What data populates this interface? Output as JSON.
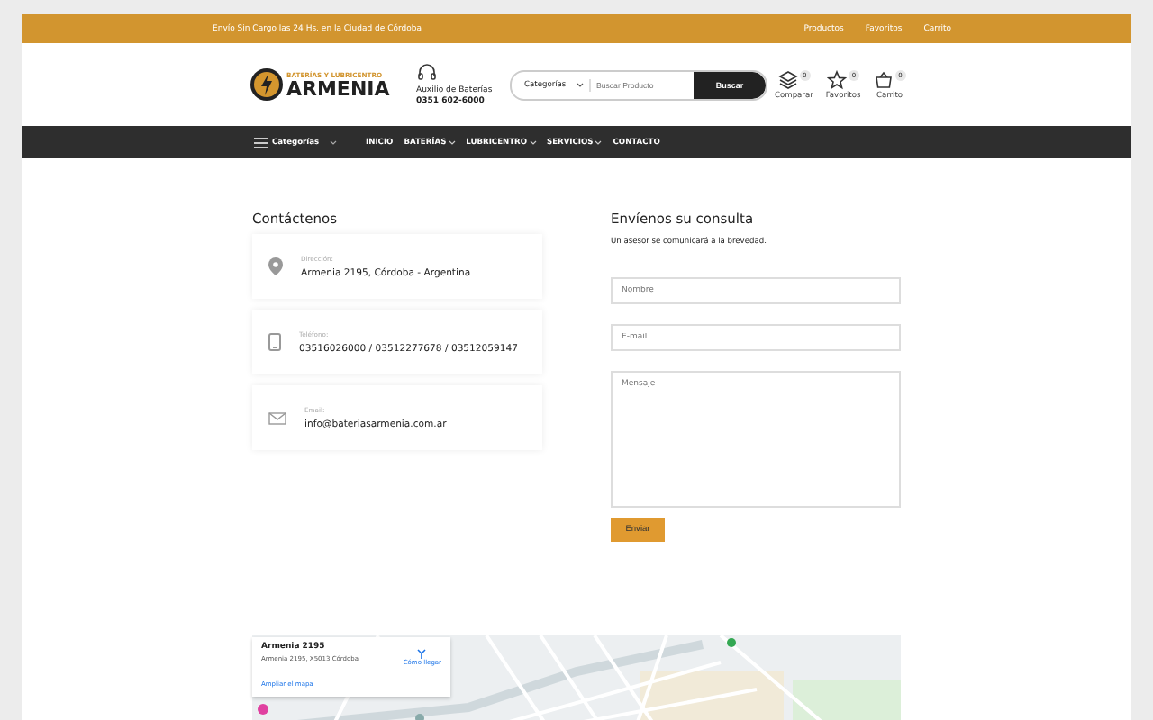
{
  "topbar": {
    "notice": "Envío Sin Cargo las 24 Hs. en la Ciudad de Córdoba",
    "links": [
      "Productos",
      "Favoritos",
      "Carrito"
    ]
  },
  "header": {
    "logo": {
      "tagline": "BATERÍAS Y LUBRICENTRO",
      "name": "ARMENIA"
    },
    "help": {
      "label": "Auxilio de Baterías",
      "phone": "0351 602-6000"
    },
    "search": {
      "category": "Categorías",
      "placeholder": "Buscar Producto",
      "button": "Buscar"
    },
    "actions": [
      {
        "kind": "compare",
        "label": "Comparar",
        "count": "0"
      },
      {
        "kind": "favorites",
        "label": "Favoritos",
        "count": "0"
      },
      {
        "kind": "cart",
        "label": "Carrito",
        "count": "0"
      }
    ]
  },
  "nav": {
    "categories": "Categorías",
    "items": [
      {
        "label": "INICIO",
        "dropdown": false
      },
      {
        "label": "BATERÍAS",
        "dropdown": true
      },
      {
        "label": "LUBRICENTRO",
        "dropdown": true
      },
      {
        "label": "SERVICIOS",
        "dropdown": true
      },
      {
        "label": "CONTACTO",
        "dropdown": false
      }
    ]
  },
  "contact": {
    "title": "Contáctenos",
    "cards": [
      {
        "kind": "location",
        "label": "Dirección:",
        "value": "Armenia 2195, Córdoba - Argentina"
      },
      {
        "kind": "phone",
        "label": "Teléfono:",
        "value": "03516026000 / 03512277678 / 03512059147"
      },
      {
        "kind": "email",
        "label": "Email:",
        "value": "info@bateriasarmenia.com.ar"
      }
    ]
  },
  "form": {
    "title": "Envíenos su consulta",
    "subtitle": "Un asesor se comunicará a la brevedad.",
    "fields": [
      {
        "kind": "input",
        "placeholder": "Nombre"
      },
      {
        "kind": "input",
        "placeholder": "E-mail"
      },
      {
        "kind": "textarea",
        "placeholder": "Mensaje"
      }
    ],
    "button": "Enviar"
  },
  "map": {
    "place": "Armenia 2195",
    "address": "Armenia 2195, X5013 Córdoba",
    "directions": "Cómo llegar",
    "enlarge": "Ampliar el mapa"
  }
}
